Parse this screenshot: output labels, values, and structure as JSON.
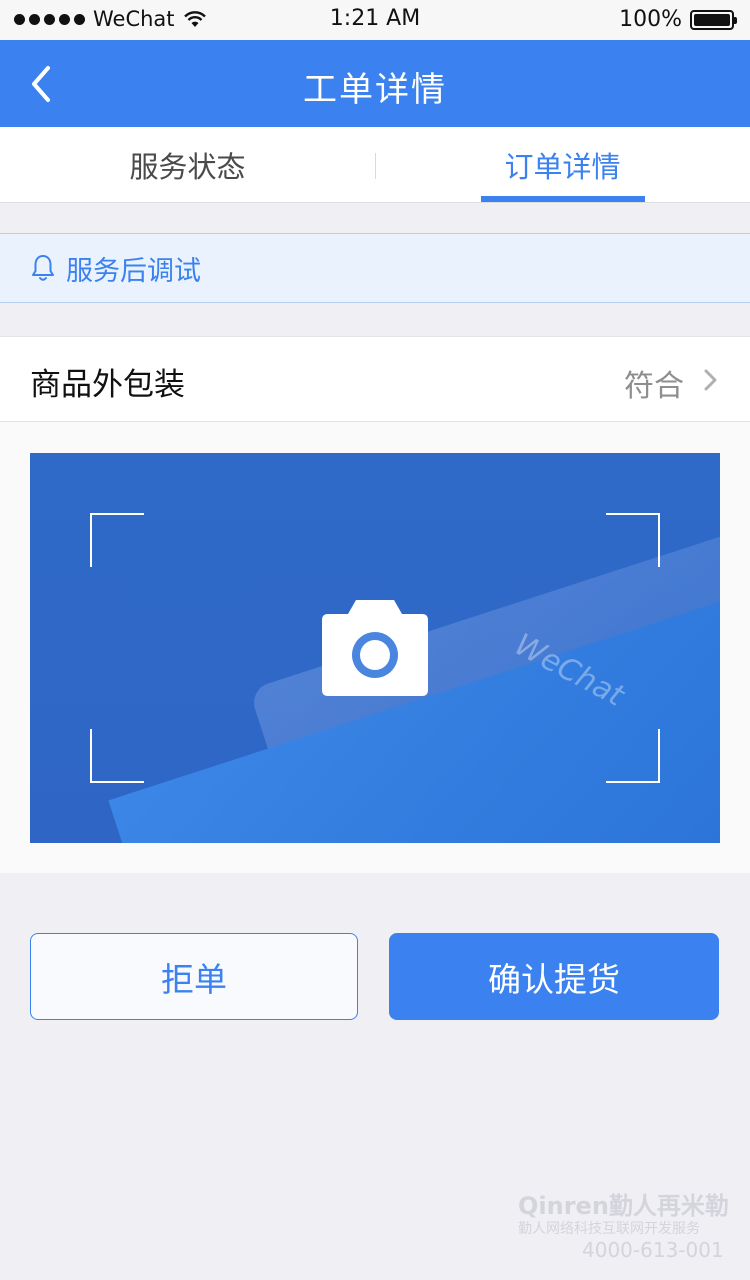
{
  "status_bar": {
    "carrier": "WeChat",
    "time": "1:21 AM",
    "battery": "100%",
    "battery_level": 1.0
  },
  "nav": {
    "title": "工单详情",
    "back_icon": "chevron-left-icon"
  },
  "tabs": [
    {
      "label": "服务状态",
      "active": false
    },
    {
      "label": "订单详情",
      "active": true
    }
  ],
  "notice": {
    "icon": "bell-icon",
    "text": "服务后调试"
  },
  "inspection_row": {
    "label": "商品外包装",
    "value": "符合",
    "icon": "chevron-right-icon"
  },
  "photo": {
    "icon": "camera-icon",
    "watermark_text": "WeChat"
  },
  "actions": {
    "reject_label": "拒单",
    "confirm_label": "确认提货"
  },
  "brand_watermark": {
    "line1": "Qinren勤人再米勒",
    "line2": "勤人网络科技互联网开发服务",
    "line3": "4000-613-001"
  },
  "colors": {
    "accent": "#3b82f0",
    "background": "#efeff4"
  }
}
